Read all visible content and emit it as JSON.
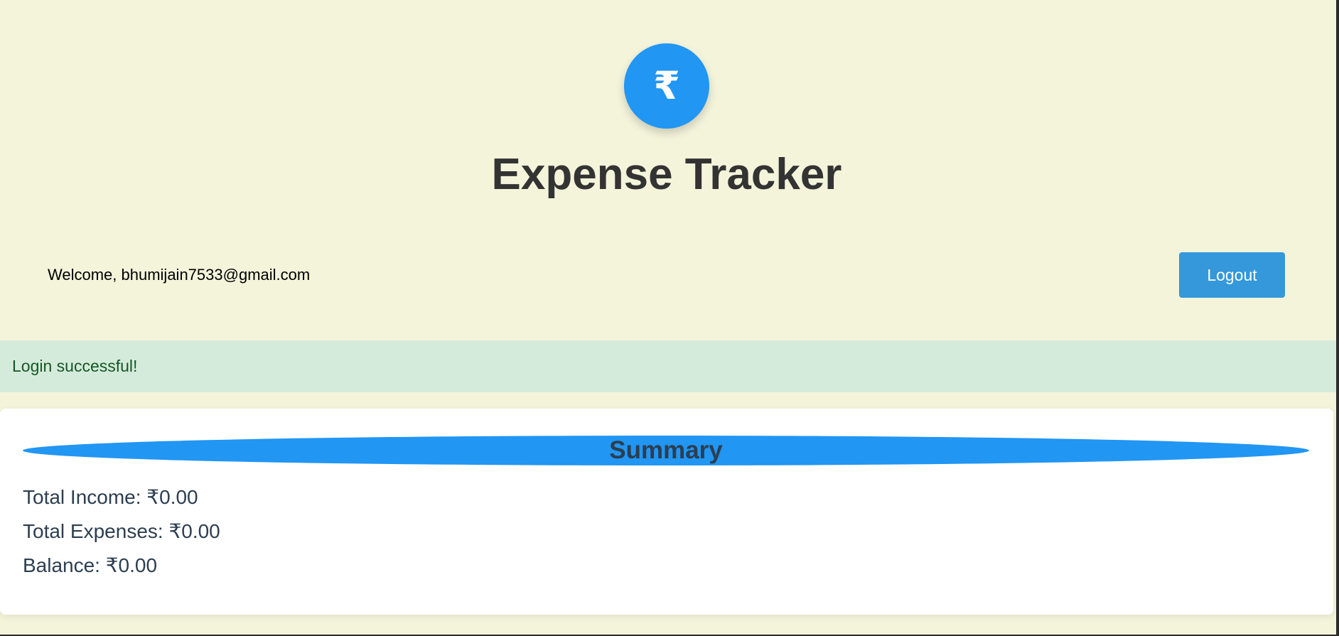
{
  "header": {
    "logo_symbol": "₹",
    "title": "Expense Tracker"
  },
  "user_bar": {
    "welcome_text": "Welcome, bhumijain7533@gmail.com",
    "logout_label": "Logout"
  },
  "flash": {
    "message": "Login successful!"
  },
  "summary": {
    "heading": "Summary",
    "total_income": "Total Income: ₹0.00",
    "total_expenses": "Total Expenses: ₹0.00",
    "balance": "Balance: ₹0.00"
  },
  "colors": {
    "page_background": "#f4f4db",
    "accent_blue": "#2196f3",
    "button_blue": "#3498db",
    "success_background": "#d4ebdb",
    "success_text": "#155724",
    "heading_text": "#333333",
    "summary_text": "#2c3e50"
  },
  "icons": {
    "logo": "rupee-icon"
  }
}
